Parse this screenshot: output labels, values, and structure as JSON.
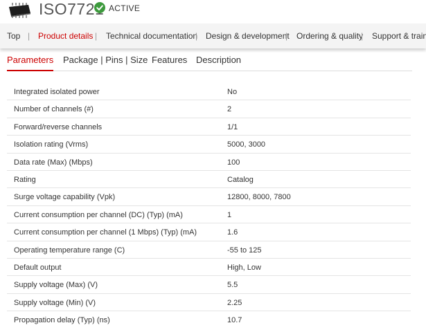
{
  "header": {
    "part_number": "ISO7721",
    "status": "ACTIVE",
    "status_color": "#3d9a3d",
    "chip_icon": "ic-package-icon",
    "status_icon": "check-circle-icon"
  },
  "nav": {
    "items": [
      {
        "label": "Top",
        "active": false
      },
      {
        "label": "Product details",
        "active": true
      },
      {
        "label": "Technical documentation",
        "active": false
      },
      {
        "label": "Design & development",
        "active": false
      },
      {
        "label": "Ordering & quality",
        "active": false
      },
      {
        "label": "Support & trainin",
        "active": false
      }
    ],
    "separator": "|",
    "active_color": "#cc0000"
  },
  "tabs": {
    "items": [
      {
        "label": "Parameters",
        "active": true
      },
      {
        "label": "Package | Pins | Size",
        "active": false
      },
      {
        "label": "Features",
        "active": false
      },
      {
        "label": "Description",
        "active": false
      }
    ]
  },
  "parameters": {
    "rows": [
      {
        "name": "Integrated isolated power",
        "value": "No"
      },
      {
        "name": "Number of channels (#)",
        "value": "2"
      },
      {
        "name": "Forward/reverse channels",
        "value": "1/1"
      },
      {
        "name": "Isolation rating (Vrms)",
        "value": "5000, 3000"
      },
      {
        "name": "Data rate (Max) (Mbps)",
        "value": "100"
      },
      {
        "name": "Rating",
        "value": "Catalog"
      },
      {
        "name": "Surge voltage capability (Vpk)",
        "value": "12800, 8000, 7800"
      },
      {
        "name": "Current consumption per channel (DC) (Typ) (mA)",
        "value": "1"
      },
      {
        "name": "Current consumption per channel (1 Mbps) (Typ) (mA)",
        "value": "1.6"
      },
      {
        "name": "Operating temperature range (C)",
        "value": "-55 to 125"
      },
      {
        "name": "Default output",
        "value": "High, Low"
      },
      {
        "name": "Supply voltage (Max) (V)",
        "value": "5.5"
      },
      {
        "name": "Supply voltage (Min) (V)",
        "value": "2.25"
      },
      {
        "name": "Propagation delay (Typ) (ns)",
        "value": "10.7"
      }
    ]
  }
}
